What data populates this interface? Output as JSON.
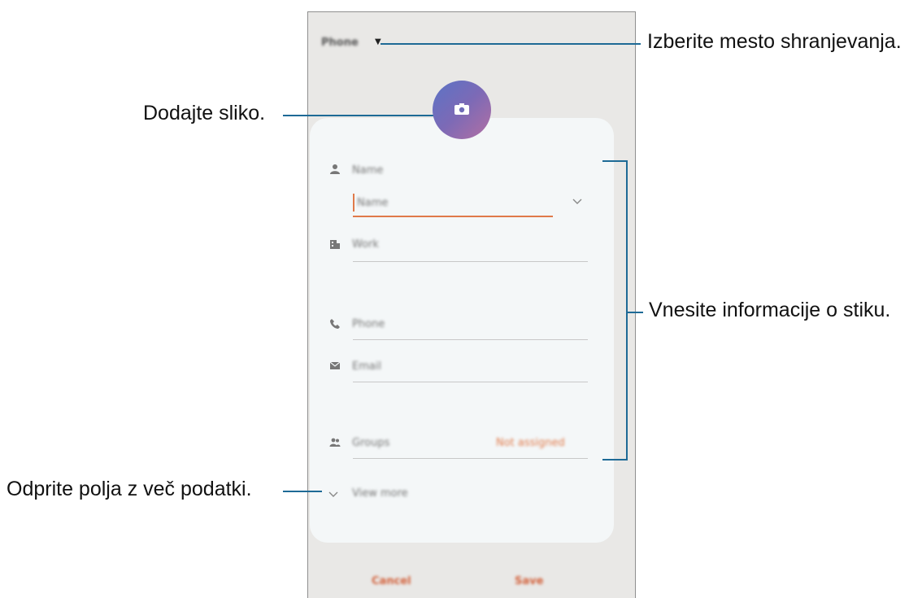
{
  "header": {
    "storage_label": "Phone",
    "storage_caret": "▼"
  },
  "fields": {
    "name_label": "Name",
    "name_input_placeholder": "Name",
    "work_label": "Work",
    "phone_label": "Phone",
    "email_label": "Email",
    "groups_label": "Groups",
    "groups_value": "Not assigned",
    "view_more_label": "View more"
  },
  "footer": {
    "cancel_label": "Cancel",
    "save_label": "Save"
  },
  "callouts": {
    "storage": "Izberite mesto shranjevanja.",
    "photo": "Dodajte sliko.",
    "info": "Vnesite informacije o stiku.",
    "more": "Odprite polja z več podatki."
  },
  "icons": {
    "camera": "camera-icon",
    "person": "person-icon",
    "work": "building-icon",
    "phone": "phone-icon",
    "email": "email-icon",
    "groups": "groups-icon",
    "expand": "chevron-down-icon"
  },
  "colors": {
    "accent": "#e07a4a",
    "annotation_line": "#1e6a96",
    "screen_bg": "#e9e8e6",
    "card_bg": "#f4f7f8"
  }
}
